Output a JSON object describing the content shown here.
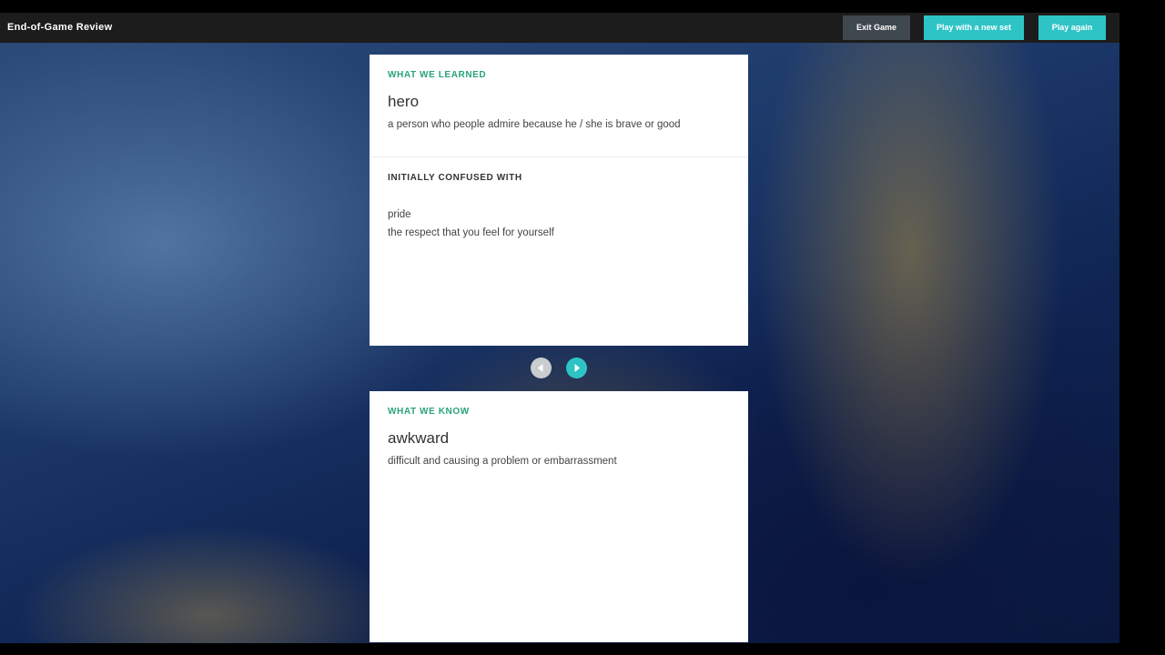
{
  "header": {
    "title": "End-of-Game Review",
    "buttons": {
      "exit": "Exit Game",
      "new_set": "Play with a new set",
      "again": "Play again"
    }
  },
  "learned": {
    "label": "WHAT WE LEARNED",
    "word": "hero",
    "definition": "a person who people admire because he / she is brave or good",
    "confused_label": "INITIALLY CONFUSED WITH",
    "confused_word": "pride",
    "confused_definition": "the respect that you feel for yourself"
  },
  "known": {
    "label": "WHAT WE KNOW",
    "word": "awkward",
    "definition": "difficult and causing a problem or embarrassment"
  },
  "navigation": {
    "prev_icon": "chevron-left-icon",
    "next_icon": "chevron-right-icon"
  },
  "colors": {
    "accent": "#2ec4c6",
    "label_green": "#2aa37a",
    "exit_button": "#3f474f",
    "topbar": "#1c1c1c"
  }
}
